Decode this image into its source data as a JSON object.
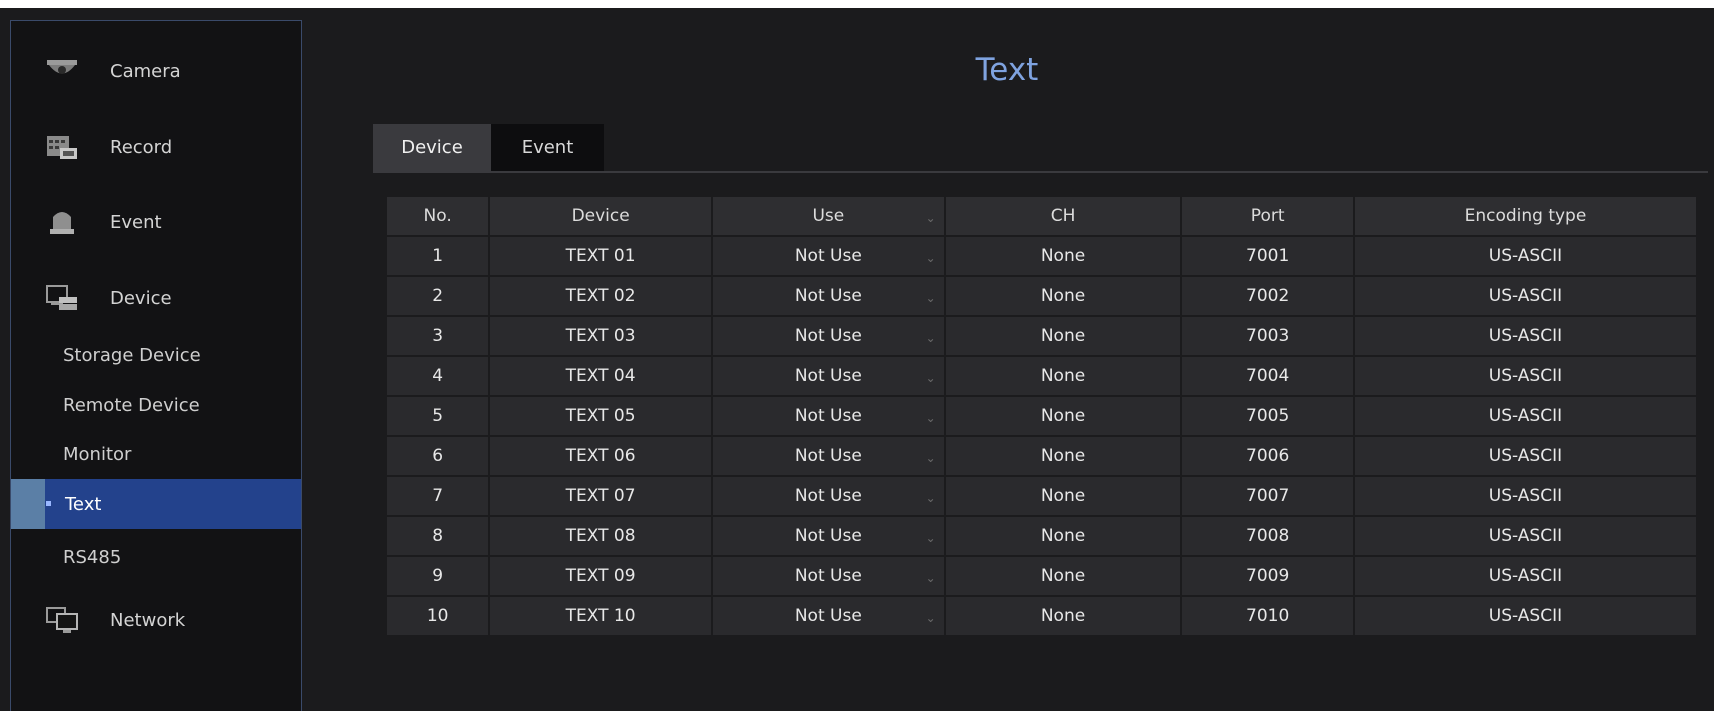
{
  "sidebar": {
    "menu": [
      {
        "label": "Camera",
        "icon": "camera-icon"
      },
      {
        "label": "Record",
        "icon": "record-icon"
      },
      {
        "label": "Event",
        "icon": "event-icon"
      },
      {
        "label": "Device",
        "icon": "device-icon"
      },
      {
        "label": "Network",
        "icon": "network-icon"
      }
    ],
    "sub_items": [
      {
        "label": "Storage Device"
      },
      {
        "label": "Remote Device"
      },
      {
        "label": "Monitor"
      },
      {
        "label": "Text"
      },
      {
        "label": "RS485"
      }
    ],
    "active_sub_item": "Text"
  },
  "page": {
    "title": "Text"
  },
  "tabs": [
    {
      "label": "Device",
      "active": true
    },
    {
      "label": "Event",
      "active": false
    }
  ],
  "table": {
    "headers": [
      "No.",
      "Device",
      "Use",
      "CH",
      "Port",
      "Encoding type"
    ],
    "rows": [
      {
        "no": "1",
        "device": "TEXT 01",
        "use": "Not Use",
        "ch": "None",
        "port": "7001",
        "encoding": "US-ASCII"
      },
      {
        "no": "2",
        "device": "TEXT 02",
        "use": "Not Use",
        "ch": "None",
        "port": "7002",
        "encoding": "US-ASCII"
      },
      {
        "no": "3",
        "device": "TEXT 03",
        "use": "Not Use",
        "ch": "None",
        "port": "7003",
        "encoding": "US-ASCII"
      },
      {
        "no": "4",
        "device": "TEXT 04",
        "use": "Not Use",
        "ch": "None",
        "port": "7004",
        "encoding": "US-ASCII"
      },
      {
        "no": "5",
        "device": "TEXT 05",
        "use": "Not Use",
        "ch": "None",
        "port": "7005",
        "encoding": "US-ASCII"
      },
      {
        "no": "6",
        "device": "TEXT 06",
        "use": "Not Use",
        "ch": "None",
        "port": "7006",
        "encoding": "US-ASCII"
      },
      {
        "no": "7",
        "device": "TEXT 07",
        "use": "Not Use",
        "ch": "None",
        "port": "7007",
        "encoding": "US-ASCII"
      },
      {
        "no": "8",
        "device": "TEXT 08",
        "use": "Not Use",
        "ch": "None",
        "port": "7008",
        "encoding": "US-ASCII"
      },
      {
        "no": "9",
        "device": "TEXT 09",
        "use": "Not Use",
        "ch": "None",
        "port": "7009",
        "encoding": "US-ASCII"
      },
      {
        "no": "10",
        "device": "TEXT 10",
        "use": "Not Use",
        "ch": "None",
        "port": "7010",
        "encoding": "US-ASCII"
      }
    ]
  },
  "colors": {
    "background": "#1b1b1d",
    "sidebar": "#121214",
    "active": "#23428c",
    "title": "#7fa3e0"
  }
}
